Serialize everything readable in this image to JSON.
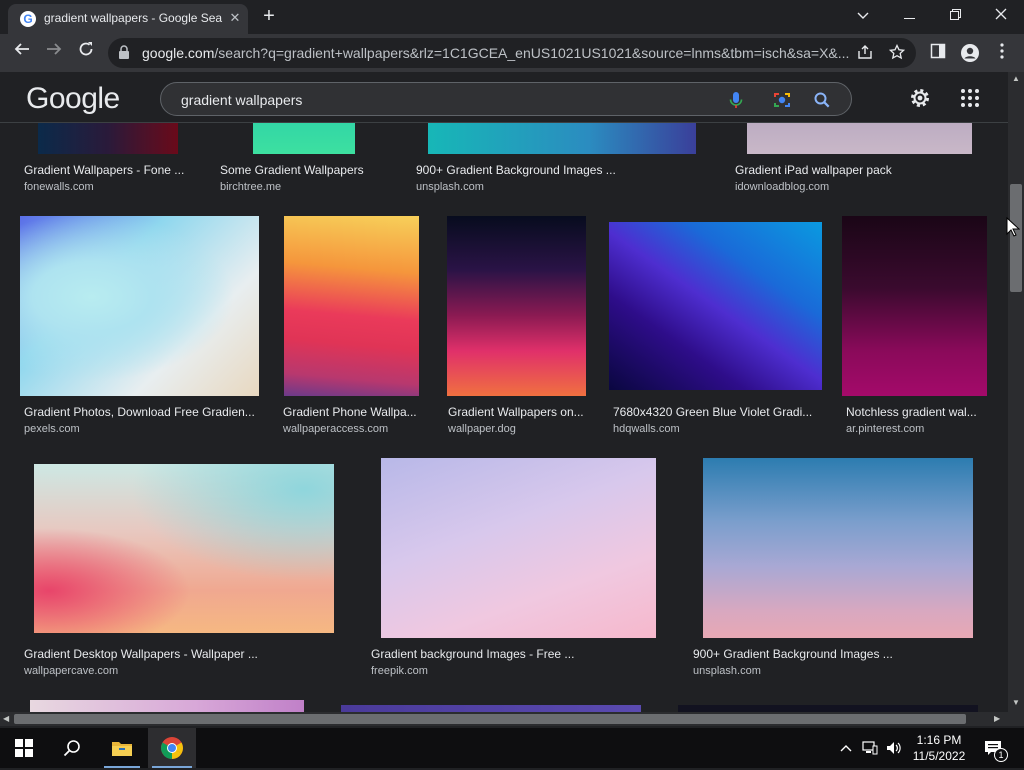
{
  "browser": {
    "tab_title": "gradient wallpapers - Google Sea",
    "url_domain": "google.com",
    "url_rest": "/search?q=gradient+wallpapers&rlz=1C1GCEA_enUS1021US1021&source=lnms&tbm=isch&sa=X&..."
  },
  "google": {
    "logo": "Google",
    "query": "gradient wallpapers"
  },
  "results": {
    "row0": [
      {
        "caption": "Gradient Wallpapers - Fone ...",
        "source": "fonewalls.com"
      },
      {
        "caption": "Some Gradient Wallpapers",
        "source": "birchtree.me"
      },
      {
        "caption": "900+ Gradient Background Images ...",
        "source": "unsplash.com"
      },
      {
        "caption": "Gradient iPad wallpaper pack",
        "source": "idownloadblog.com"
      }
    ],
    "row1": [
      {
        "caption": "Gradient Photos, Download Free Gradien...",
        "source": "pexels.com"
      },
      {
        "caption": "Gradient Phone Wallpa...",
        "source": "wallpaperaccess.com"
      },
      {
        "caption": "Gradient Wallpapers on...",
        "source": "wallpaper.dog"
      },
      {
        "caption": "7680x4320 Green Blue Violet Gradi...",
        "source": "hdqwalls.com"
      },
      {
        "caption": "Notchless gradient wal...",
        "source": "ar.pinterest.com"
      }
    ],
    "row2": [
      {
        "caption": "Gradient Desktop Wallpapers - Wallpaper ...",
        "source": "wallpapercave.com"
      },
      {
        "caption": "Gradient background Images - Free ...",
        "source": "freepik.com"
      },
      {
        "caption": "900+ Gradient Background Images ...",
        "source": "unsplash.com"
      }
    ]
  },
  "taskbar": {
    "time": "1:16 PM",
    "date": "11/5/2022",
    "notification_count": "1"
  }
}
